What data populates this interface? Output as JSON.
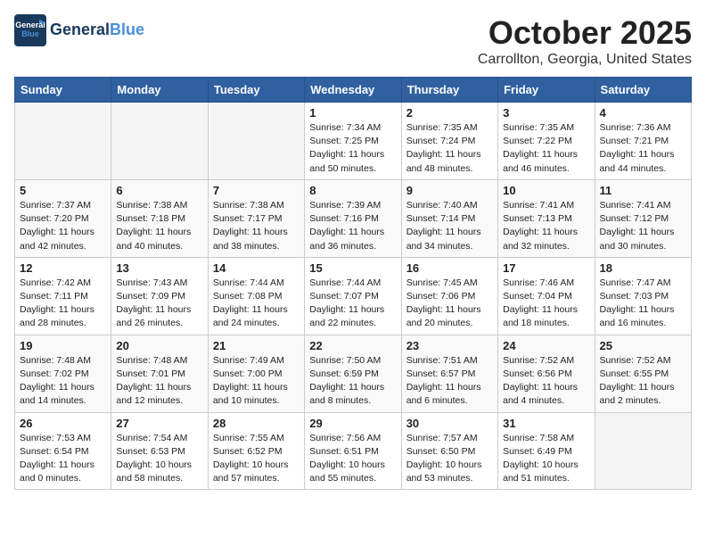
{
  "header": {
    "logo_line1": "General",
    "logo_line2": "Blue",
    "month": "October 2025",
    "location": "Carrollton, Georgia, United States"
  },
  "weekdays": [
    "Sunday",
    "Monday",
    "Tuesday",
    "Wednesday",
    "Thursday",
    "Friday",
    "Saturday"
  ],
  "weeks": [
    [
      {
        "day": "",
        "sunrise": "",
        "sunset": "",
        "daylight": "",
        "empty": true
      },
      {
        "day": "",
        "sunrise": "",
        "sunset": "",
        "daylight": "",
        "empty": true
      },
      {
        "day": "",
        "sunrise": "",
        "sunset": "",
        "daylight": "",
        "empty": true
      },
      {
        "day": "1",
        "sunrise": "Sunrise: 7:34 AM",
        "sunset": "Sunset: 7:25 PM",
        "daylight": "Daylight: 11 hours and 50 minutes."
      },
      {
        "day": "2",
        "sunrise": "Sunrise: 7:35 AM",
        "sunset": "Sunset: 7:24 PM",
        "daylight": "Daylight: 11 hours and 48 minutes."
      },
      {
        "day": "3",
        "sunrise": "Sunrise: 7:35 AM",
        "sunset": "Sunset: 7:22 PM",
        "daylight": "Daylight: 11 hours and 46 minutes."
      },
      {
        "day": "4",
        "sunrise": "Sunrise: 7:36 AM",
        "sunset": "Sunset: 7:21 PM",
        "daylight": "Daylight: 11 hours and 44 minutes."
      }
    ],
    [
      {
        "day": "5",
        "sunrise": "Sunrise: 7:37 AM",
        "sunset": "Sunset: 7:20 PM",
        "daylight": "Daylight: 11 hours and 42 minutes."
      },
      {
        "day": "6",
        "sunrise": "Sunrise: 7:38 AM",
        "sunset": "Sunset: 7:18 PM",
        "daylight": "Daylight: 11 hours and 40 minutes."
      },
      {
        "day": "7",
        "sunrise": "Sunrise: 7:38 AM",
        "sunset": "Sunset: 7:17 PM",
        "daylight": "Daylight: 11 hours and 38 minutes."
      },
      {
        "day": "8",
        "sunrise": "Sunrise: 7:39 AM",
        "sunset": "Sunset: 7:16 PM",
        "daylight": "Daylight: 11 hours and 36 minutes."
      },
      {
        "day": "9",
        "sunrise": "Sunrise: 7:40 AM",
        "sunset": "Sunset: 7:14 PM",
        "daylight": "Daylight: 11 hours and 34 minutes."
      },
      {
        "day": "10",
        "sunrise": "Sunrise: 7:41 AM",
        "sunset": "Sunset: 7:13 PM",
        "daylight": "Daylight: 11 hours and 32 minutes."
      },
      {
        "day": "11",
        "sunrise": "Sunrise: 7:41 AM",
        "sunset": "Sunset: 7:12 PM",
        "daylight": "Daylight: 11 hours and 30 minutes."
      }
    ],
    [
      {
        "day": "12",
        "sunrise": "Sunrise: 7:42 AM",
        "sunset": "Sunset: 7:11 PM",
        "daylight": "Daylight: 11 hours and 28 minutes."
      },
      {
        "day": "13",
        "sunrise": "Sunrise: 7:43 AM",
        "sunset": "Sunset: 7:09 PM",
        "daylight": "Daylight: 11 hours and 26 minutes."
      },
      {
        "day": "14",
        "sunrise": "Sunrise: 7:44 AM",
        "sunset": "Sunset: 7:08 PM",
        "daylight": "Daylight: 11 hours and 24 minutes."
      },
      {
        "day": "15",
        "sunrise": "Sunrise: 7:44 AM",
        "sunset": "Sunset: 7:07 PM",
        "daylight": "Daylight: 11 hours and 22 minutes."
      },
      {
        "day": "16",
        "sunrise": "Sunrise: 7:45 AM",
        "sunset": "Sunset: 7:06 PM",
        "daylight": "Daylight: 11 hours and 20 minutes."
      },
      {
        "day": "17",
        "sunrise": "Sunrise: 7:46 AM",
        "sunset": "Sunset: 7:04 PM",
        "daylight": "Daylight: 11 hours and 18 minutes."
      },
      {
        "day": "18",
        "sunrise": "Sunrise: 7:47 AM",
        "sunset": "Sunset: 7:03 PM",
        "daylight": "Daylight: 11 hours and 16 minutes."
      }
    ],
    [
      {
        "day": "19",
        "sunrise": "Sunrise: 7:48 AM",
        "sunset": "Sunset: 7:02 PM",
        "daylight": "Daylight: 11 hours and 14 minutes."
      },
      {
        "day": "20",
        "sunrise": "Sunrise: 7:48 AM",
        "sunset": "Sunset: 7:01 PM",
        "daylight": "Daylight: 11 hours and 12 minutes."
      },
      {
        "day": "21",
        "sunrise": "Sunrise: 7:49 AM",
        "sunset": "Sunset: 7:00 PM",
        "daylight": "Daylight: 11 hours and 10 minutes."
      },
      {
        "day": "22",
        "sunrise": "Sunrise: 7:50 AM",
        "sunset": "Sunset: 6:59 PM",
        "daylight": "Daylight: 11 hours and 8 minutes."
      },
      {
        "day": "23",
        "sunrise": "Sunrise: 7:51 AM",
        "sunset": "Sunset: 6:57 PM",
        "daylight": "Daylight: 11 hours and 6 minutes."
      },
      {
        "day": "24",
        "sunrise": "Sunrise: 7:52 AM",
        "sunset": "Sunset: 6:56 PM",
        "daylight": "Daylight: 11 hours and 4 minutes."
      },
      {
        "day": "25",
        "sunrise": "Sunrise: 7:52 AM",
        "sunset": "Sunset: 6:55 PM",
        "daylight": "Daylight: 11 hours and 2 minutes."
      }
    ],
    [
      {
        "day": "26",
        "sunrise": "Sunrise: 7:53 AM",
        "sunset": "Sunset: 6:54 PM",
        "daylight": "Daylight: 11 hours and 0 minutes."
      },
      {
        "day": "27",
        "sunrise": "Sunrise: 7:54 AM",
        "sunset": "Sunset: 6:53 PM",
        "daylight": "Daylight: 10 hours and 58 minutes."
      },
      {
        "day": "28",
        "sunrise": "Sunrise: 7:55 AM",
        "sunset": "Sunset: 6:52 PM",
        "daylight": "Daylight: 10 hours and 57 minutes."
      },
      {
        "day": "29",
        "sunrise": "Sunrise: 7:56 AM",
        "sunset": "Sunset: 6:51 PM",
        "daylight": "Daylight: 10 hours and 55 minutes."
      },
      {
        "day": "30",
        "sunrise": "Sunrise: 7:57 AM",
        "sunset": "Sunset: 6:50 PM",
        "daylight": "Daylight: 10 hours and 53 minutes."
      },
      {
        "day": "31",
        "sunrise": "Sunrise: 7:58 AM",
        "sunset": "Sunset: 6:49 PM",
        "daylight": "Daylight: 10 hours and 51 minutes."
      },
      {
        "day": "",
        "sunrise": "",
        "sunset": "",
        "daylight": "",
        "empty": true
      }
    ]
  ]
}
